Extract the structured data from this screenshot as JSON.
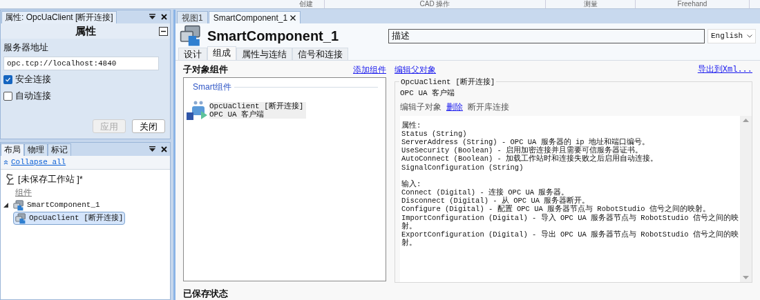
{
  "ribbon_groups": [
    "创建",
    "CAD 操作",
    "测量",
    "Freehand"
  ],
  "properties_panel": {
    "tab_title": "属性: OpcUaClient [断开连接]",
    "heading": "属性",
    "field_label": "服务器地址",
    "field_value": "opc.tcp://localhost:4840",
    "checkboxes": [
      {
        "label": "安全连接",
        "checked": true
      },
      {
        "label": "自动连接",
        "checked": false
      }
    ],
    "buttons": [
      {
        "label": "应用",
        "disabled": true
      },
      {
        "label": "关闭",
        "disabled": false
      }
    ]
  },
  "layout_panel": {
    "tabs": [
      {
        "label": "布局",
        "selected": true
      },
      {
        "label": "物理",
        "selected": false
      },
      {
        "label": "标记",
        "selected": false
      }
    ],
    "collapse_link": "Collapse all",
    "tree": [
      {
        "label": "[未保存工作站 ]*",
        "kind": "station",
        "selected": false,
        "children": [
          {
            "label": "组件",
            "kind": "group",
            "selected": false
          }
        ]
      },
      {
        "label": "SmartComponent_1",
        "kind": "component",
        "selected": false,
        "expanded": true,
        "children": [
          {
            "label": "OpcUaClient [断开连接]",
            "kind": "component",
            "selected": true
          }
        ]
      }
    ]
  },
  "document": {
    "tabs": [
      {
        "label": "视图1",
        "selected": false
      },
      {
        "label": "SmartComponent_1",
        "selected": true
      }
    ],
    "title": "SmartComponent_1",
    "description": "描述",
    "language": "English",
    "sub_tabs": [
      {
        "label": "设计",
        "selected": false
      },
      {
        "label": "组成",
        "selected": true
      },
      {
        "label": "属性与连结",
        "selected": false
      },
      {
        "label": "信号和连接",
        "selected": false
      }
    ],
    "children_heading": "子对象组件",
    "add_link": "添加组件",
    "group_title": "Smart组件",
    "components": [
      {
        "name": "OpcUaClient [断开连接]",
        "description": "OPC UA 客户端"
      }
    ],
    "saved_state_heading": "已保存状态",
    "edit_parent_link": "编辑父对象",
    "export_link": "导出到Xml...",
    "selected_component": {
      "title": "OpcUaClient [断开连接]",
      "description": "OPC UA 客户端",
      "actions": [
        {
          "label": "编辑子对象",
          "kind": "text"
        },
        {
          "label": "删除",
          "kind": "link"
        },
        {
          "label": "断开库连接",
          "kind": "text"
        }
      ],
      "sections": [
        {
          "heading": "属性:",
          "lines": [
            "Status (String)",
            "ServerAddress (String) - OPC UA 服务器的 ip 地址和端口编号。",
            "UseSecurity (Boolean) - 启用加密连接并且需要可信服务器证书。",
            "AutoConnect (Boolean) - 加载工作站时和连接失败之后启用自动连接。",
            "SignalConfiguration (String)"
          ]
        },
        {
          "heading": "输入:",
          "lines": [
            "Connect (Digital) - 连接 OPC UA 服务器。",
            "Disconnect (Digital) - 从 OPC UA 服务器断开。",
            "Configure (Digital) - 配置 OPC UA 服务器节点与 RobotStudio 信号之间的映射。",
            "ImportConfiguration (Digital) - 导入 OPC UA 服务器节点与 RobotStudio 信号之间的映射。",
            "ExportConfiguration (Digital) - 导出 OPC UA 服务器节点与 RobotStudio 信号之间的映射。"
          ]
        }
      ]
    }
  }
}
